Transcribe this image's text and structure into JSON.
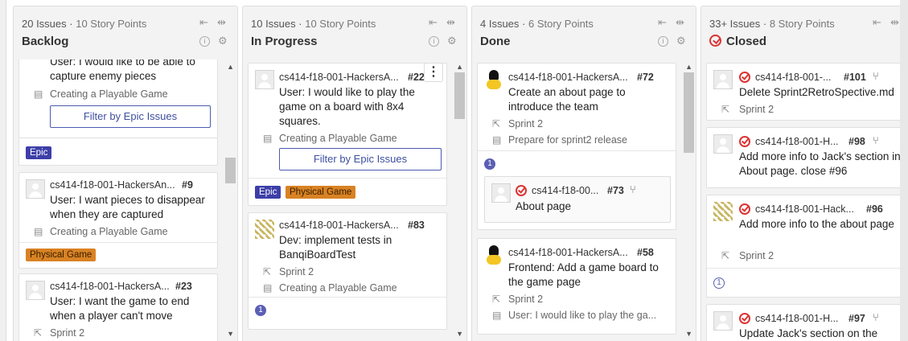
{
  "columns": {
    "backlog": {
      "count": "20 Issues",
      "points": "10 Story Points",
      "title": "Backlog"
    },
    "progress": {
      "count": "10 Issues",
      "points": "10 Story Points",
      "title": "In Progress"
    },
    "done": {
      "count": "4 Issues",
      "points": "6 Story Points",
      "title": "Done"
    },
    "closed": {
      "count": "33+ Issues",
      "points": "8 Story Points",
      "title": "Closed"
    }
  },
  "icons": {
    "filter": "⇤",
    "collapse": "⇹",
    "info": "i",
    "gear": "⚙",
    "sprint": "⇱",
    "epic_link": "▤",
    "pr": "⑂",
    "up": "▲",
    "down": "▼",
    "kebab": "⋮"
  },
  "filter_label": "Filter by Epic Issues",
  "backlog_cards": {
    "c1": {
      "title": "User: I would like to be able to capture enemy pieces",
      "epic": "Creating a Playable Game",
      "label": "Epic"
    },
    "c2": {
      "ref": "cs414-f18-001-HackersAn...",
      "num": "#9",
      "title": "User: I want pieces to disappear when they are captured",
      "epic": "Creating a Playable Game",
      "label": "Physical Game"
    },
    "c3": {
      "ref": "cs414-f18-001-HackersA...",
      "num": "#23",
      "title": "User: I want the game to end when a player can't move",
      "sprint": "Sprint 2"
    }
  },
  "progress_cards": {
    "c1": {
      "ref": "cs414-f18-001-HackersA...",
      "num": "#22",
      "title": "User: I would like to play the game on a board with 8x4 squares.",
      "epic": "Creating a Playable Game",
      "label1": "Epic",
      "label2": "Physical Game"
    },
    "c2": {
      "ref": "cs414-f18-001-HackersA...",
      "num": "#83",
      "title": "Dev: implement tests in BanqiBoardTest",
      "sprint": "Sprint 2",
      "epic": "Creating a Playable Game",
      "weight": "1"
    }
  },
  "done_cards": {
    "c1": {
      "ref": "cs414-f18-001-HackersA...",
      "num": "#72",
      "title": "Create an about page to introduce the team",
      "sprint": "Sprint 2",
      "epic": "Prepare for sprint2 release",
      "weight": "1",
      "sub_ref": "cs414-f18-00...",
      "sub_num": "#73",
      "sub_title": "About page"
    },
    "c2": {
      "ref": "cs414-f18-001-HackersA...",
      "num": "#58",
      "title": "Frontend: Add a game board to the game page",
      "sprint": "Sprint 2",
      "epic": "User: I would like to play the ga..."
    }
  },
  "closed_cards": {
    "c1": {
      "ref": "cs414-f18-001-...",
      "num": "#101",
      "title": "Delete Sprint2RetroSpective.md",
      "sprint": "Sprint 2"
    },
    "c2": {
      "ref": "cs414-f18-001-H...",
      "num": "#98",
      "title": "Add more info to Jack's section in About page. close #96"
    },
    "c3": {
      "ref": "cs414-f18-001-Hack...",
      "num": "#96",
      "title": "Add more info to the about page",
      "sprint": "Sprint 2",
      "weight": "1"
    },
    "c4": {
      "ref": "cs414-f18-001-H...",
      "num": "#97",
      "title": "Update Jack's section on the"
    }
  },
  "colors": {
    "epic": "#3d3fa8",
    "physical_game": "#d98224",
    "closed_red": "#dd3333",
    "weight": "#5b5fb4"
  }
}
